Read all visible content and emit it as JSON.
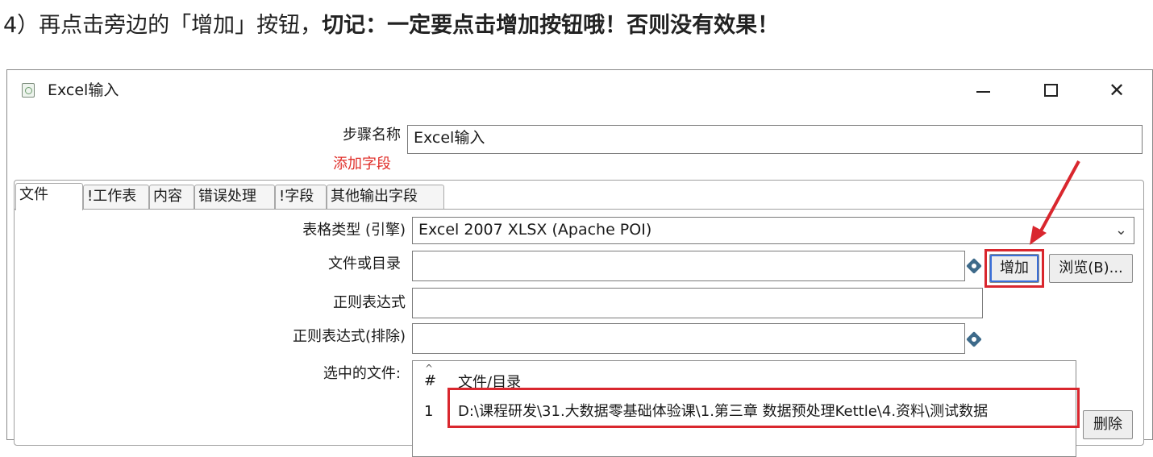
{
  "instruction": {
    "normal": "4）再点击旁边的「增加」按钮，",
    "bold": "切记：一定要点击增加按钮哦！否则没有效果！"
  },
  "window": {
    "title": "Excel输入",
    "controls": {
      "minimize": "—",
      "maximize": "☐",
      "close": "✕"
    }
  },
  "step": {
    "label": "步骤名称",
    "value": "Excel输入",
    "add_field_link": "添加字段"
  },
  "tabs": [
    "文件",
    "!工作表",
    "内容",
    "错误处理",
    "!字段",
    "其他输出字段"
  ],
  "file_tab": {
    "engine_label": "表格类型 (引擎)",
    "engine_value": "Excel 2007 XLSX (Apache POI)",
    "file_label": "文件或目录",
    "file_value": "",
    "add_button": "增加",
    "browse_button": "浏览(B)...",
    "regex_label": "正则表达式",
    "regex_value": "",
    "regex_exclude_label": "正则表达式(排除)",
    "regex_exclude_value": "",
    "selected_label": "选中的文件:",
    "table": {
      "headers": [
        "#",
        "文件/目录"
      ],
      "rows": [
        {
          "num": "1",
          "path": "D:\\课程研发\\31.大数据零基础体验课\\1.第三章 数据预处理Kettle\\4.资料\\测试数据"
        }
      ]
    },
    "delete_button": "删除"
  },
  "colors": {
    "highlight": "#d9272e",
    "accent": "#3a6fd8",
    "link_red": "#e0302b"
  }
}
